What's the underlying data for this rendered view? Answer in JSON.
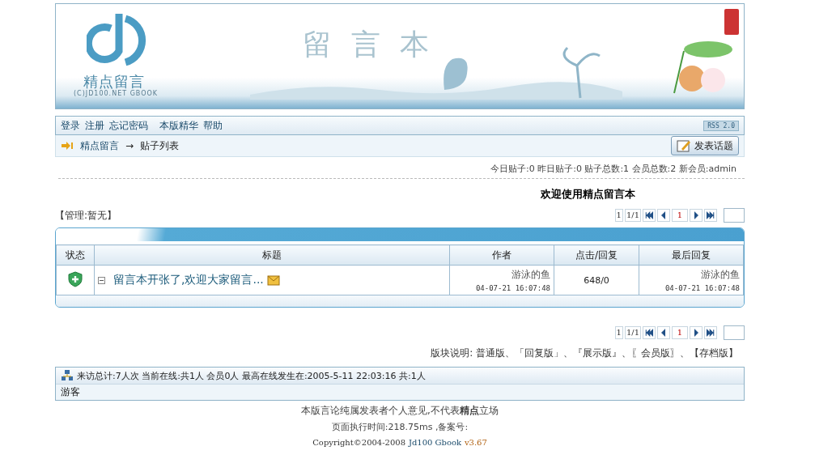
{
  "banner": {
    "logo_text": "精点留言",
    "logo_sub": "(C)JD100.NET GBOOK",
    "title": "留言本"
  },
  "nav": {
    "links": [
      "登录",
      "注册",
      "忘记密码",
      "本版精华",
      "帮助"
    ],
    "rss": "RSS 2.0"
  },
  "breadcrumb": {
    "items": [
      "精点留言",
      "贴子列表"
    ],
    "separator": "→",
    "post_button": "发表话题"
  },
  "stats": "今日贴子:0 昨日贴子:0 贴子总数:1 会员总数:2 新会员:admin",
  "welcome": "欢迎使用精点留言本",
  "moderators": "【管理:暂无】",
  "pager_top": {
    "pages": "1",
    "current_of": "1/1",
    "page": "1"
  },
  "table": {
    "columns": [
      "状态",
      "标题",
      "作者",
      "点击/回复",
      "最后回复"
    ],
    "rows": [
      {
        "title": "留言本开张了,欢迎大家留言...",
        "expanded": true,
        "author": "游泳的鱼",
        "time": "04-07-21 16:07:48",
        "hits": "648/0",
        "last_author": "游泳的鱼",
        "last_time": "04-07-21 16:07:48"
      }
    ]
  },
  "pager_bottom": {
    "pages": "1",
    "current_of": "1/1",
    "page": "1"
  },
  "legend": "版块说明: 普通版、「回复版」、『展示版』、〖会员版〗、【存档版】",
  "online": {
    "summary": "来访总计:7人次 当前在线:共1人 会员0人 最高在线发生在:2005-5-11 22:03:16 共:1人",
    "guests": "游客"
  },
  "footer": {
    "disclaimer": "本版言论纯属发表者个人意见,不代表**精点**立场",
    "exec": "页面执行时间:218.75ms ,备案号:",
    "copyright": "Copyright©2004-2008",
    "product": "Jd100 Gbook",
    "version": "v3.67"
  }
}
